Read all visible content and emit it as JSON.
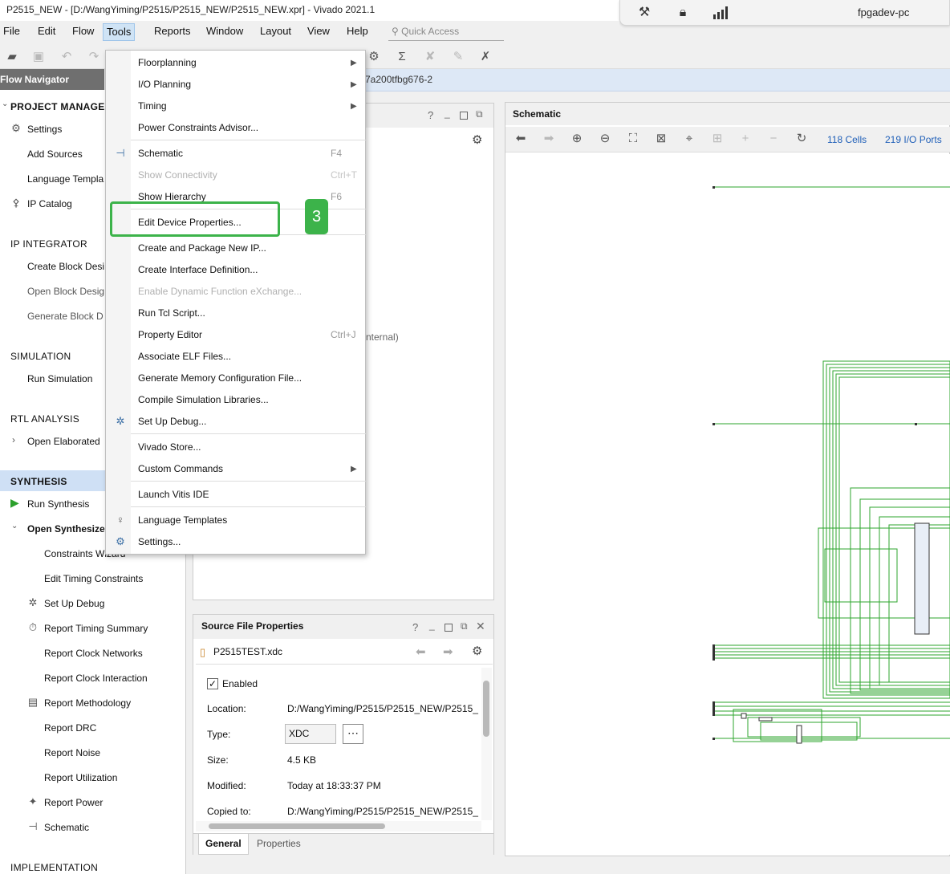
{
  "window": {
    "title": "P2515_NEW - [D:/WangYiming/P2515/P2515_NEW/P2515_NEW.xpr] - Vivado 2021.1"
  },
  "status_overlay": {
    "host": "fpgadev-pc",
    "icons": [
      "tools-crossed-icon",
      "lock-icon",
      "signal-bars-icon"
    ]
  },
  "menubar": {
    "items": [
      "File",
      "Edit",
      "Flow",
      "Tools",
      "Reports",
      "Window",
      "Layout",
      "View",
      "Help"
    ],
    "active": "Tools",
    "quick_access_placeholder": "Quick Access"
  },
  "project_bar": {
    "part_suffix": "7a200tfbg676-2"
  },
  "flow_navigator": {
    "title": "Flow Navigator",
    "sections": {
      "project_manager": {
        "label": "PROJECT MANAGER",
        "items": [
          "Settings",
          "Add Sources",
          "Language Templa",
          "IP Catalog"
        ]
      },
      "ip_integrator": {
        "label": "IP INTEGRATOR",
        "items": [
          "Create Block Desi",
          "Open Block Desig",
          "Generate Block D"
        ]
      },
      "simulation": {
        "label": "SIMULATION",
        "items": [
          "Run Simulation"
        ]
      },
      "rtl_analysis": {
        "label": "RTL ANALYSIS",
        "items": [
          "Open Elaborated"
        ]
      },
      "synthesis": {
        "label": "SYNTHESIS",
        "items": [
          "Run Synthesis",
          "Open Synthesize"
        ],
        "sub_items": [
          "Constraints Wizard",
          "Edit Timing Constraints",
          "Set Up Debug",
          "Report Timing Summary",
          "Report Clock Networks",
          "Report Clock Interaction",
          "Report Methodology",
          "Report DRC",
          "Report Noise",
          "Report Utilization",
          "Report Power",
          "Schematic"
        ]
      },
      "implementation": {
        "label": "IMPLEMENTATION"
      }
    }
  },
  "tools_menu": {
    "items": [
      {
        "label": "Floorplanning",
        "submenu": true
      },
      {
        "label": "I/O Planning",
        "submenu": true
      },
      {
        "label": "Timing",
        "submenu": true
      },
      {
        "label": "Power Constraints Advisor..."
      },
      {
        "label": "Schematic",
        "shortcut": "F4"
      },
      {
        "label": "Show Connectivity",
        "shortcut": "Ctrl+T",
        "disabled": true
      },
      {
        "label": "Show Hierarchy",
        "shortcut": "F6"
      },
      {
        "label": "Edit Device Properties..."
      },
      {
        "label": "Create and Package New IP..."
      },
      {
        "label": "Create Interface Definition..."
      },
      {
        "label": "Enable Dynamic Function eXchange...",
        "disabled": true
      },
      {
        "label": "Run Tcl Script..."
      },
      {
        "label": "Property Editor",
        "shortcut": "Ctrl+J"
      },
      {
        "label": "Associate ELF Files..."
      },
      {
        "label": "Generate Memory Configuration File..."
      },
      {
        "label": "Compile Simulation Libraries..."
      },
      {
        "label": "Set Up Debug..."
      },
      {
        "label": "Vivado Store..."
      },
      {
        "label": "Custom Commands",
        "submenu": true
      },
      {
        "label": "Launch Vitis IDE"
      },
      {
        "label": "Language Templates"
      },
      {
        "label": "Settings..."
      }
    ]
  },
  "annotation": {
    "step_number": "3"
  },
  "center_panel": {
    "partial_text": "nternal)"
  },
  "source_file_properties": {
    "title": "Source File Properties",
    "file": "P2515TEST.xdc",
    "enabled_label": "Enabled",
    "enabled": true,
    "fields": {
      "location_label": "Location:",
      "location_value": "D:/WangYiming/P2515/P2515_NEW/P2515_",
      "type_label": "Type:",
      "type_value": "XDC",
      "size_label": "Size:",
      "size_value": "4.5 KB",
      "modified_label": "Modified:",
      "modified_value": "Today at 18:33:37 PM",
      "copied_label": "Copied to:",
      "copied_value": "D:/WangYiming/P2515/P2515_NEW/P2515_"
    },
    "tabs": [
      "General",
      "Properties"
    ],
    "active_tab": "General"
  },
  "schematic": {
    "title": "Schematic",
    "cells": "118 Cells",
    "ports": "219 I/O Ports"
  },
  "colors": {
    "accent": "#3cb34a",
    "wire": "#2ea52e",
    "link": "#1f5fb8",
    "selection": "#cfe0f5"
  }
}
